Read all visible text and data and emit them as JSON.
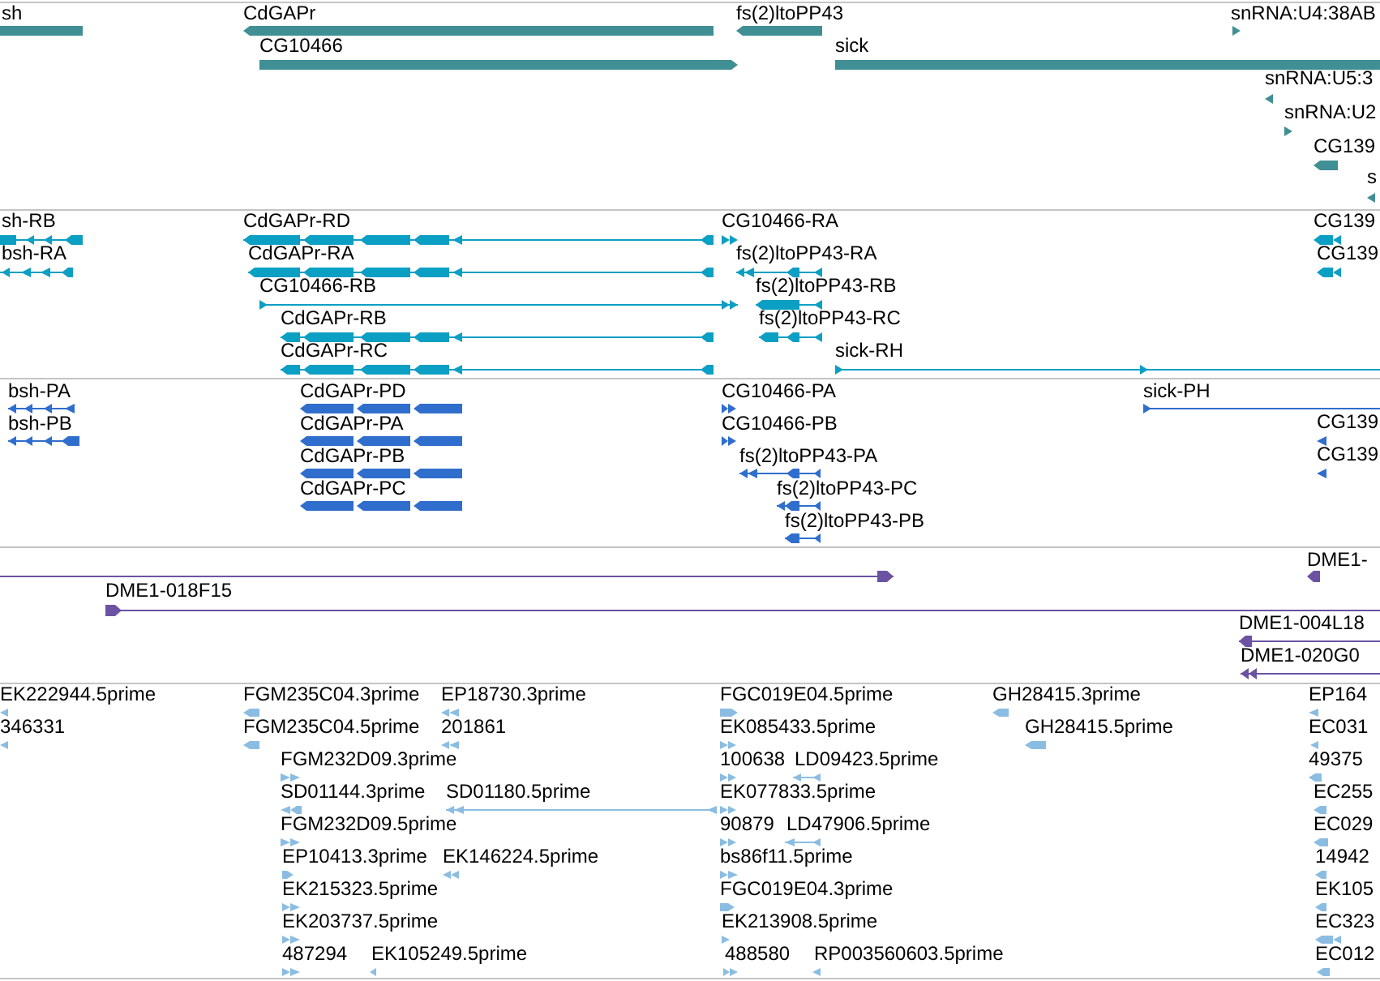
{
  "tracks": [
    {
      "kind": "gene",
      "features": [
        {
          "label": "sh",
          "reverse": true
        },
        {
          "label": "CdGAPr",
          "reverse": true
        },
        {
          "label": "fs(2)ltoPP43",
          "reverse": true
        },
        {
          "label": "snRNA:U4:38AB",
          "reverse": false
        },
        {
          "label": "CG10466",
          "reverse": false
        },
        {
          "label": "sick",
          "reverse": false
        },
        {
          "label": "snRNA:U5:3",
          "reverse": true
        },
        {
          "label": "snRNA:U2",
          "reverse": false
        },
        {
          "label": "CG139",
          "reverse": true
        },
        {
          "label": "s",
          "reverse": true
        }
      ]
    },
    {
      "kind": "transcript",
      "features": [
        {
          "label": "sh-RB",
          "reverse": true
        },
        {
          "label": "bsh-RA",
          "reverse": true
        },
        {
          "label": "CdGAPr-RD",
          "reverse": true
        },
        {
          "label": "CdGAPr-RA",
          "reverse": true
        },
        {
          "label": "CG10466-RB",
          "reverse": false
        },
        {
          "label": "CdGAPr-RB",
          "reverse": true
        },
        {
          "label": "CdGAPr-RC",
          "reverse": true
        },
        {
          "label": "CG10466-RA",
          "reverse": false
        },
        {
          "label": "fs(2)ltoPP43-RA",
          "reverse": true
        },
        {
          "label": "fs(2)ltoPP43-RB",
          "reverse": true
        },
        {
          "label": "fs(2)ltoPP43-RC",
          "reverse": true
        },
        {
          "label": "sick-RH",
          "reverse": false
        },
        {
          "label": "CG139",
          "reverse": true
        },
        {
          "label": "CG139",
          "reverse": true
        }
      ]
    },
    {
      "kind": "protein",
      "features": [
        {
          "label": "bsh-PA",
          "reverse": true
        },
        {
          "label": "bsh-PB",
          "reverse": true
        },
        {
          "label": "CdGAPr-PD",
          "reverse": true
        },
        {
          "label": "CdGAPr-PA",
          "reverse": true
        },
        {
          "label": "CdGAPr-PB",
          "reverse": true
        },
        {
          "label": "CdGAPr-PC",
          "reverse": true
        },
        {
          "label": "CG10466-PA",
          "reverse": false
        },
        {
          "label": "CG10466-PB",
          "reverse": false
        },
        {
          "label": "fs(2)ltoPP43-PA",
          "reverse": true
        },
        {
          "label": "fs(2)ltoPP43-PC",
          "reverse": true
        },
        {
          "label": "fs(2)ltoPP43-PB",
          "reverse": true
        },
        {
          "label": "sick-PH",
          "reverse": false
        },
        {
          "label": "CG139",
          "reverse": true
        },
        {
          "label": "CG139",
          "reverse": true
        }
      ]
    },
    {
      "kind": "bac",
      "features": [
        {
          "reverse": false
        },
        {
          "label": "DME1-018F15",
          "reverse": false
        },
        {
          "label": "DME1-",
          "reverse": true
        },
        {
          "label": "DME1-004L18",
          "reverse": true
        },
        {
          "label": "DME1-020G0",
          "reverse": true
        }
      ]
    },
    {
      "kind": "est",
      "features": [
        {
          "label": "EK222944.5prime",
          "reverse": true
        },
        {
          "label": "FGM235C04.3prime",
          "reverse": true
        },
        {
          "label": "EP18730.3prime",
          "reverse": true
        },
        {
          "label": "FGC019E04.5prime",
          "reverse": false
        },
        {
          "label": "GH28415.3prime",
          "reverse": true
        },
        {
          "label": "EP164",
          "reverse": true
        },
        {
          "label": "346331",
          "reverse": true
        },
        {
          "label": "FGM235C04.5prime",
          "reverse": true
        },
        {
          "label": "201861",
          "reverse": true
        },
        {
          "label": "EK085433.5prime",
          "reverse": false
        },
        {
          "label": "GH28415.5prime",
          "reverse": true
        },
        {
          "label": "EC031",
          "reverse": true
        },
        {
          "label": "FGM232D09.3prime",
          "reverse": false
        },
        {
          "label": "100638",
          "reverse": false
        },
        {
          "label": "LD09423.5prime",
          "reverse": true
        },
        {
          "label": "49375",
          "reverse": true
        },
        {
          "label": "SD01144.3prime",
          "reverse": true
        },
        {
          "label": "SD01180.5prime",
          "reverse": true
        },
        {
          "label": "EK077833.5prime",
          "reverse": false
        },
        {
          "label": "EC255",
          "reverse": true
        },
        {
          "label": "FGM232D09.5prime",
          "reverse": false
        },
        {
          "label": "90879",
          "reverse": false
        },
        {
          "label": "LD47906.5prime",
          "reverse": true
        },
        {
          "label": "EC029",
          "reverse": true
        },
        {
          "label": "EP10413.3prime",
          "reverse": false
        },
        {
          "label": "EK146224.5prime",
          "reverse": true
        },
        {
          "label": "bs86f11.5prime",
          "reverse": false
        },
        {
          "label": "14942",
          "reverse": true
        },
        {
          "label": "EK215323.5prime",
          "reverse": false
        },
        {
          "label": "FGC019E04.3prime",
          "reverse": false
        },
        {
          "label": "EK105",
          "reverse": true
        },
        {
          "label": "EK203737.5prime",
          "reverse": false
        },
        {
          "label": "EK213908.5prime",
          "reverse": false
        },
        {
          "label": "EC323",
          "reverse": true
        },
        {
          "label": "487294",
          "reverse": false
        },
        {
          "label": "EK105249.5prime",
          "reverse": true
        },
        {
          "label": "488580",
          "reverse": false
        },
        {
          "label": "RP003560603.5prime",
          "reverse": true
        },
        {
          "label": "EC012",
          "reverse": true
        }
      ]
    }
  ]
}
